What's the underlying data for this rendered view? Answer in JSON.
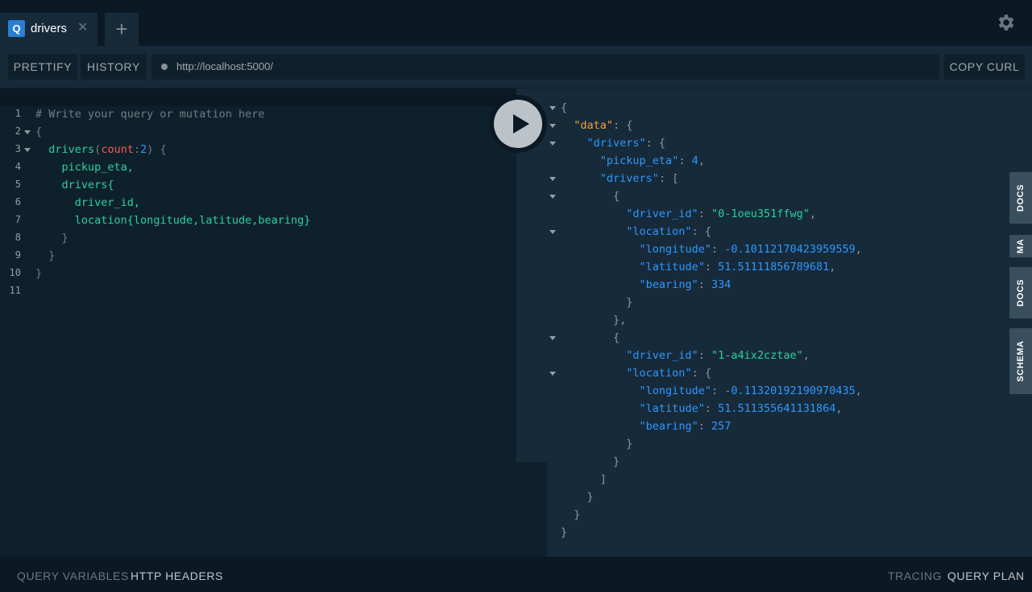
{
  "tabs": [
    {
      "badge": "Q",
      "label": "drivers",
      "close": "✕"
    }
  ],
  "tab_add": "+",
  "icons": {
    "settings": "gear-icon",
    "close": "close-icon",
    "add": "plus-icon",
    "run": "play-icon"
  },
  "toolbar": {
    "prettify": "PRETTIFY",
    "history": "HISTORY",
    "url": "http://localhost:5000/",
    "copy_curl": "COPY CURL"
  },
  "editor": {
    "line_numbers": [
      "1",
      "2",
      "3",
      "4",
      "5",
      "6",
      "7",
      "8",
      "9",
      "10",
      "11"
    ],
    "comment": "# Write your query or mutation here",
    "brace_open": "{",
    "brace_close": "}",
    "field_drivers": "drivers",
    "arg_name": "count",
    "arg_value": "2",
    "field_pickup_eta": "pickup_eta,",
    "field_drivers_inner": "drivers{",
    "field_driver_id": "driver_id,",
    "field_location": "location{longitude,latitude,bearing}"
  },
  "result": {
    "data_key": "\"data\"",
    "drivers_key": "\"drivers\"",
    "pickup_eta_key": "\"pickup_eta\"",
    "pickup_eta_value": "4",
    "drivers_list_key": "\"drivers\"",
    "driver_id_key": "\"driver_id\"",
    "location_key": "\"location\"",
    "longitude_key": "\"longitude\"",
    "latitude_key": "\"latitude\"",
    "bearing_key": "\"bearing\"",
    "items": [
      {
        "driver_id": "\"0-1oeu351ffwg\"",
        "longitude": "-0.10112170423959559",
        "latitude": "51.51111856789681",
        "bearing": "334"
      },
      {
        "driver_id": "\"1-a4ix2cztae\"",
        "longitude": "-0.11320192190970435",
        "latitude": "51.511355641131864",
        "bearing": "257"
      }
    ]
  },
  "side_tabs": [
    "DOCS",
    "MA",
    "DOCS",
    "SCHEMA"
  ],
  "bottom": {
    "query_variables": "QUERY VARIABLES",
    "http_headers": "HTTP HEADERS",
    "tracing": "TRACING",
    "query_plan": "QUERY PLAN"
  },
  "colors": {
    "background": "#0f202d",
    "panel": "#172a3a",
    "field": "#2bd19b",
    "argument": "#f25c54",
    "number": "#2e98ff",
    "data_key": "#f0a23b",
    "badge": "#2a7ed2"
  }
}
